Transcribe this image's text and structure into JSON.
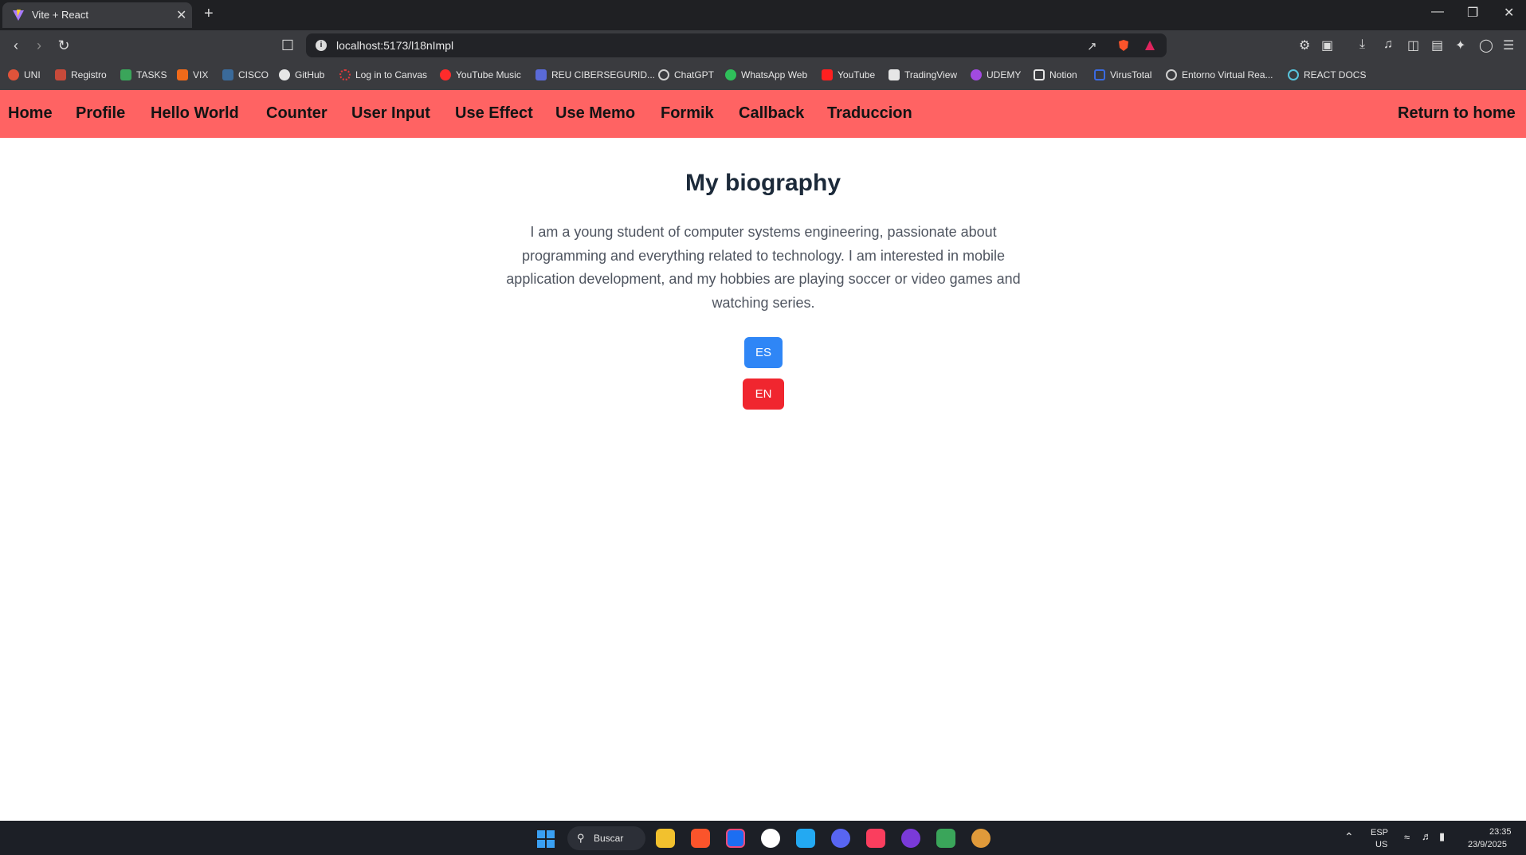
{
  "browser": {
    "tab_title": "Vite + React",
    "tab_close": "✕",
    "new_tab": "+",
    "url": "localhost:5173/l18nImpl",
    "url_info": "i",
    "window_controls": [
      "—",
      "❐",
      "✕"
    ],
    "bookmarks": [
      {
        "label": "UNI",
        "color": "#e0533a"
      },
      {
        "label": "Registro",
        "color": "#c84a3a"
      },
      {
        "label": "TASKS",
        "color": "#3aa55a"
      },
      {
        "label": "VIX",
        "color": "#f06a1a"
      },
      {
        "label": "CISCO",
        "color": "#3a6a9a"
      },
      {
        "label": "GitHub",
        "color": "#e6e6e6"
      },
      {
        "label": "Log in to Canvas",
        "color": "#e03a3a"
      },
      {
        "label": "YouTube Music",
        "color": "#ff2b2b"
      },
      {
        "label": "REU CIBERSEGURID...",
        "color": "#5a6ad8"
      },
      {
        "label": "ChatGPT",
        "color": "#cfcfcf"
      },
      {
        "label": "WhatsApp Web",
        "color": "#2fbf5a"
      },
      {
        "label": "YouTube",
        "color": "#ff2020"
      },
      {
        "label": "TradingView",
        "color": "#e6e6e6"
      },
      {
        "label": "UDEMY",
        "color": "#a24ae0"
      },
      {
        "label": "Notion",
        "color": "#e6e6e6"
      },
      {
        "label": "VirusTotal",
        "color": "#3a6ae0"
      },
      {
        "label": "Entorno Virtual Rea...",
        "color": "#cfcfcf"
      },
      {
        "label": "REACT DOCS",
        "color": "#58c4dc"
      }
    ]
  },
  "app_nav": {
    "links": [
      "Home",
      "Profile",
      "Hello World",
      "Counter",
      "User Input",
      "Use Effect",
      "Use Memo",
      "Formik",
      "Callback",
      "Traduccion"
    ],
    "return_home": "Return to home",
    "bg_color": "#ff6363"
  },
  "main": {
    "title": "My biography",
    "bio": "I am a young student of computer systems engineering, passionate about programming and everything related to technology. I am interested in mobile application development, and my hobbies are playing soccer or video games and watching series.",
    "btn_es": "ES",
    "btn_en": "EN",
    "btn_es_color": "#2f86f6",
    "btn_en_color": "#f0262f"
  },
  "taskbar": {
    "search_label": "Buscar",
    "lang_top": "ESP",
    "lang_bottom": "US",
    "time": "23:35",
    "date": "23/9/2025"
  }
}
